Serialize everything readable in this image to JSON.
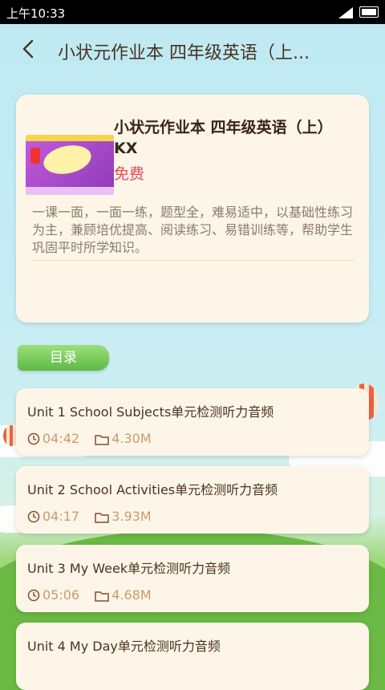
{
  "status_bar": {
    "time": "上午10:33"
  },
  "header": {
    "title": "小状元作业本 四年级英语（上..."
  },
  "book": {
    "title": "小状元作业本 四年级英语（上）KX",
    "price": "免费",
    "description": "一课一面，一面一练，题型全，难易适中，以基础性练习为主，兼顾培优提高、阅读练习、易错训练等，帮助学生巩固平时所学知识。"
  },
  "catalog": {
    "tab_label": "目录"
  },
  "tracks": [
    {
      "name": "Unit 1 School Subjects单元检测听力音频",
      "duration": "04:42",
      "size": "4.30M"
    },
    {
      "name": "Unit 2 School Activities单元检测听力音频",
      "duration": "04:17",
      "size": "3.93M"
    },
    {
      "name": "Unit 3 My Week单元检测听力音频",
      "duration": "05:06",
      "size": "4.68M"
    },
    {
      "name": "Unit 4 My Day单元检测听力音频",
      "duration": "",
      "size": ""
    }
  ]
}
